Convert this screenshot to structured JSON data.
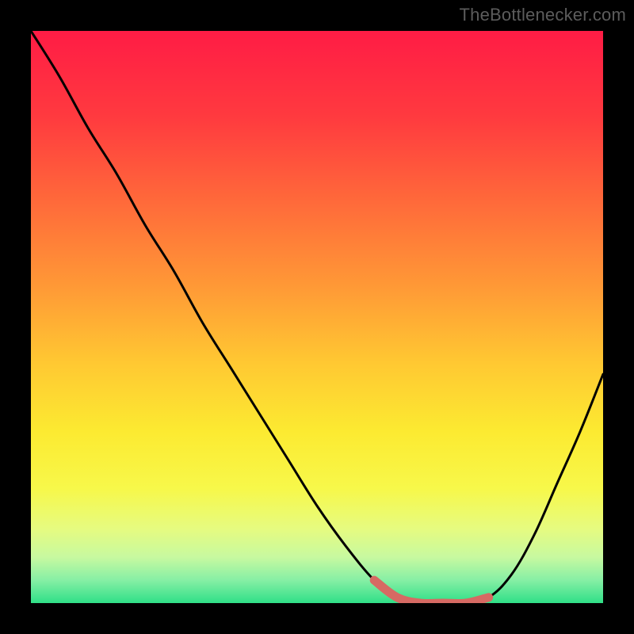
{
  "watermark": "TheBottleneсker.com",
  "chart_data": {
    "type": "line",
    "title": "",
    "xlabel": "",
    "ylabel": "",
    "xlim": [
      0,
      100
    ],
    "ylim": [
      0,
      100
    ],
    "series": [
      {
        "name": "main-curve",
        "color": "#000000",
        "x": [
          0,
          5,
          10,
          15,
          20,
          25,
          30,
          35,
          40,
          45,
          50,
          55,
          60,
          64,
          68,
          72,
          76,
          80,
          84,
          88,
          92,
          96,
          100
        ],
        "y": [
          100,
          92,
          83,
          75,
          66,
          58,
          49,
          41,
          33,
          25,
          17,
          10,
          4,
          1,
          0,
          0,
          0,
          1,
          5,
          12,
          21,
          30,
          40
        ]
      },
      {
        "name": "highlight-segment",
        "color": "#d66a63",
        "x": [
          60,
          64,
          68,
          72,
          76,
          80
        ],
        "y": [
          4,
          1,
          0,
          0,
          0,
          1
        ]
      }
    ],
    "background_gradient": {
      "stops": [
        {
          "offset": 0.0,
          "color": "#ff1c45"
        },
        {
          "offset": 0.15,
          "color": "#ff3a3f"
        },
        {
          "offset": 0.3,
          "color": "#ff6a3a"
        },
        {
          "offset": 0.45,
          "color": "#ff9a36"
        },
        {
          "offset": 0.58,
          "color": "#ffc832"
        },
        {
          "offset": 0.7,
          "color": "#fcea31"
        },
        {
          "offset": 0.8,
          "color": "#f7f84a"
        },
        {
          "offset": 0.87,
          "color": "#e6fb80"
        },
        {
          "offset": 0.92,
          "color": "#c7f9a0"
        },
        {
          "offset": 0.96,
          "color": "#86efa5"
        },
        {
          "offset": 1.0,
          "color": "#2fdf87"
        }
      ]
    }
  }
}
